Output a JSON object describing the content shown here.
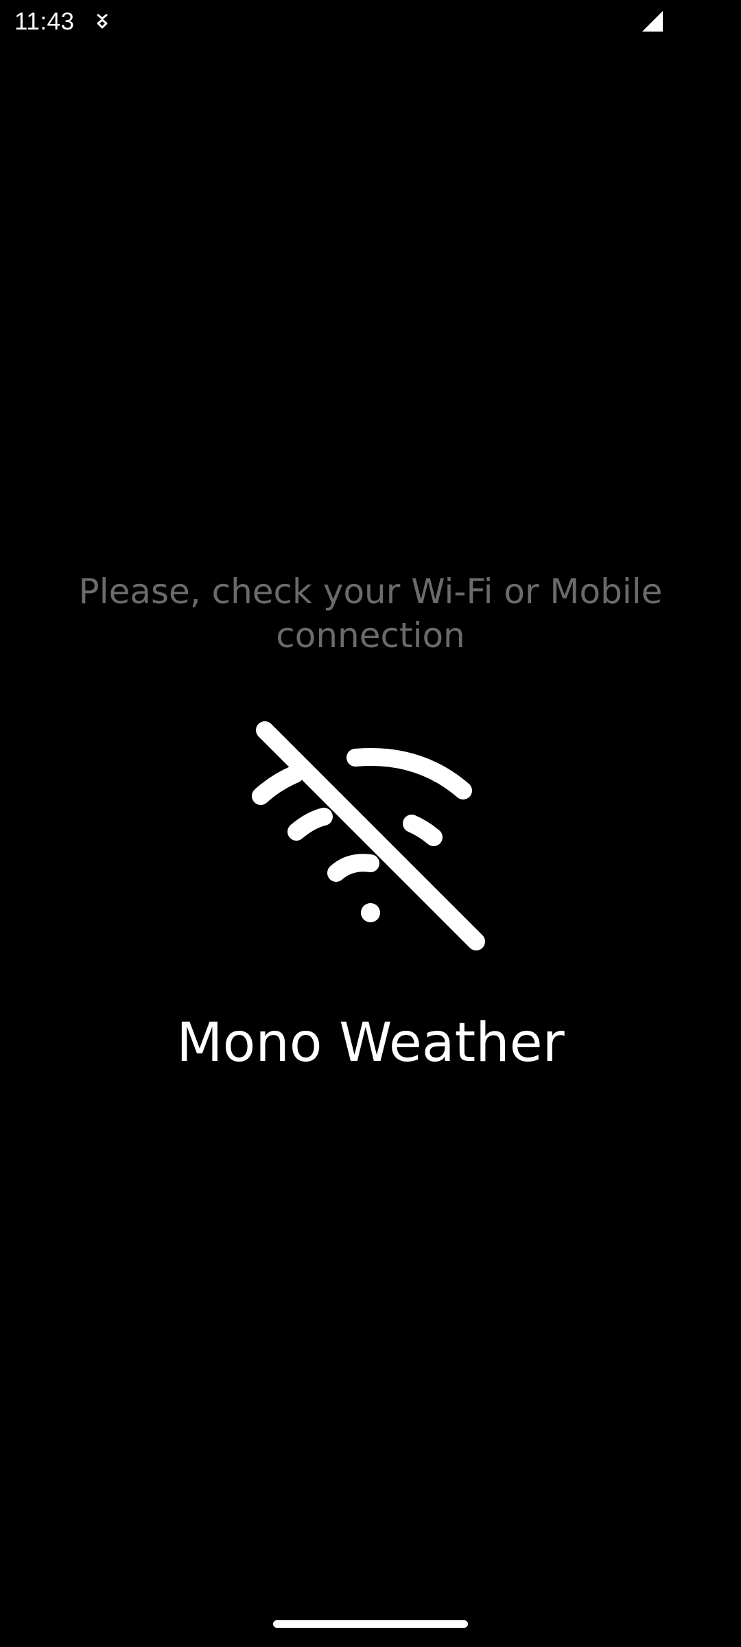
{
  "status_bar": {
    "time": "11:43",
    "notification_icon": "download-arrow-icon",
    "signal_icon": "cell-signal-icon"
  },
  "main": {
    "message": "Please, check your Wi-Fi or Mobile connection",
    "icon": "wifi-off-icon",
    "app_title": "Mono Weather"
  },
  "colors": {
    "background": "#000000",
    "message_text": "#6b6b6b",
    "foreground": "#ffffff"
  }
}
